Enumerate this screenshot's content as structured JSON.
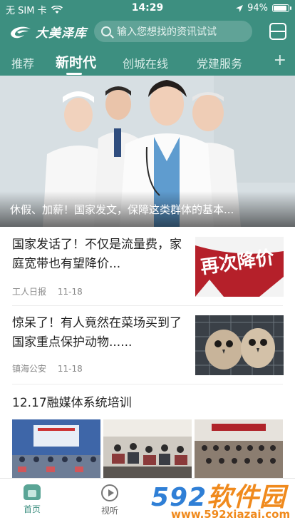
{
  "status_bar": {
    "carrier": "无 SIM 卡",
    "time": "14:29",
    "battery": "94%",
    "battery_level": 0.94
  },
  "header": {
    "logo_text": "大美泽库",
    "search_placeholder": "输入您想找的资讯试试"
  },
  "tabs": [
    "推荐",
    "新时代",
    "创城在线",
    "党建服务"
  ],
  "active_tab": "新时代",
  "hero": {
    "caption": "休假、加薪！国家发文，保障这类群体的基本..."
  },
  "news": [
    {
      "title": "国家发话了！不仅是流量费，家庭宽带也有望降价...",
      "source": "工人日报",
      "date": "11-18",
      "thumb_text": "再次降价"
    },
    {
      "title": "惊呆了！有人竟然在菜场买到了国家重点保护动物......",
      "source": "镇海公安",
      "date": "11-18",
      "thumb_text": ""
    }
  ],
  "section": {
    "title": "12.17融媒体系统培训"
  },
  "bottom_nav": [
    {
      "label": "首页",
      "icon": "home-icon"
    },
    {
      "label": "视听",
      "icon": "play-icon"
    }
  ],
  "watermark": {
    "brand": "592软件园",
    "url": "www.592xiazai.com"
  },
  "colors": {
    "brand": "#3d8f80",
    "watermark_blue": "#2f7fd6",
    "watermark_orange": "#f08a1d"
  }
}
